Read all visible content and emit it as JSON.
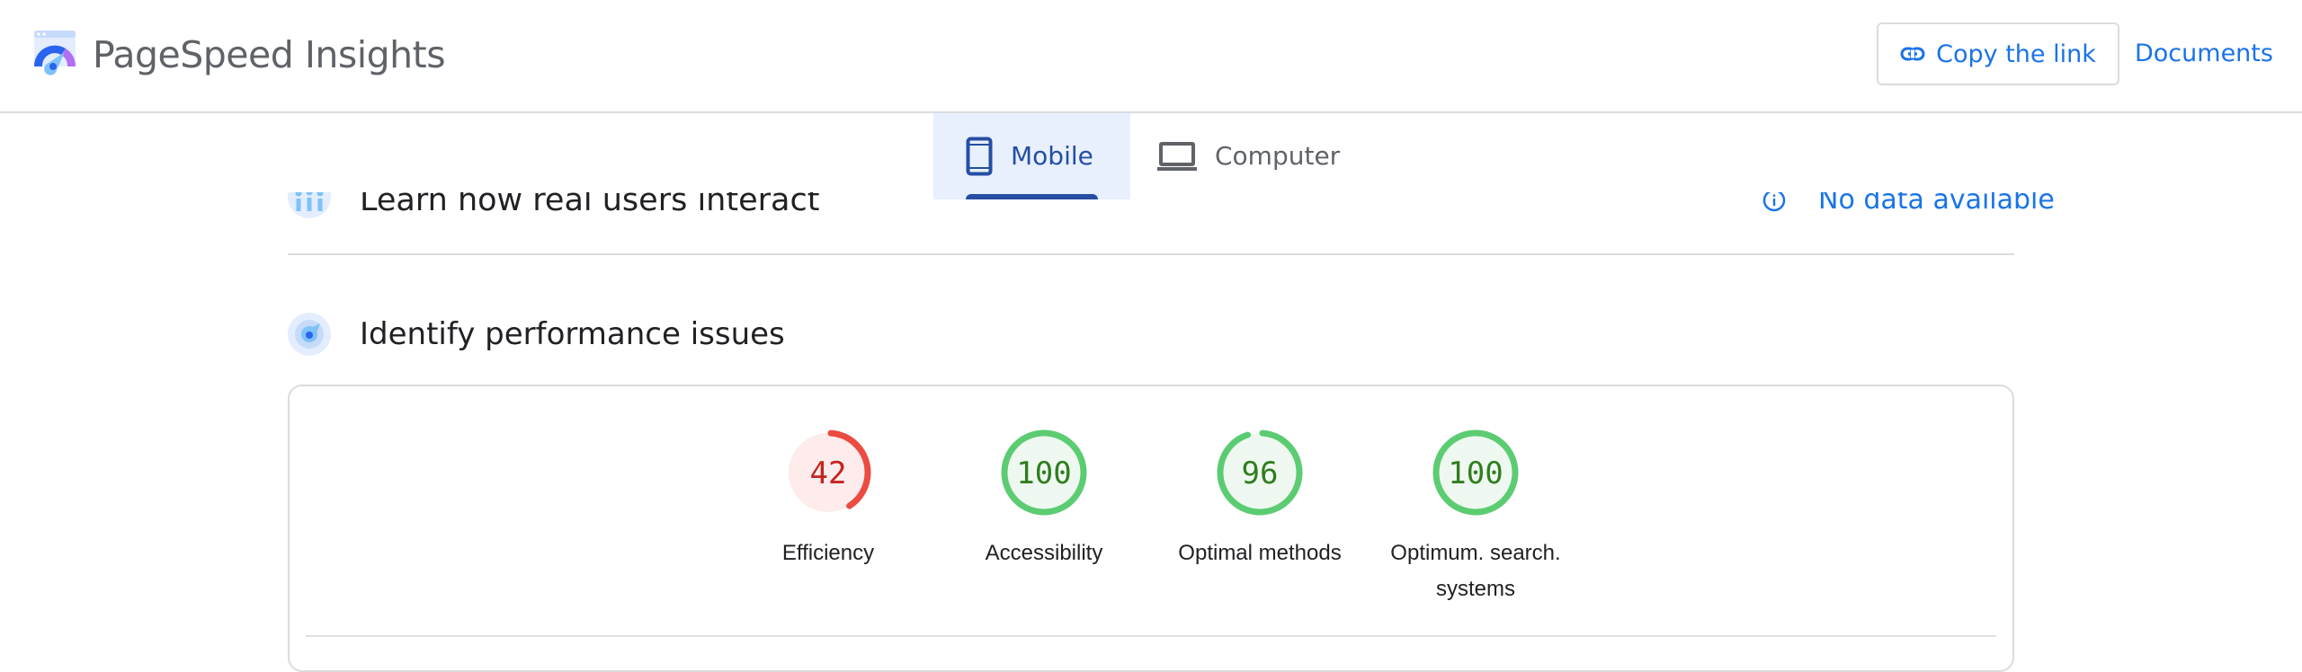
{
  "header": {
    "app_title": "PageSpeed Insights",
    "logo_icon": "pagespeed-logo-icon",
    "copy_link_label": "Copy the link",
    "copy_link_icon": "link-icon",
    "documents_label": "Documents"
  },
  "tabs": [
    {
      "label": "Mobile",
      "icon": "smartphone-icon",
      "active": true
    },
    {
      "label": "Computer",
      "icon": "laptop-icon",
      "active": false
    }
  ],
  "field_data_section": {
    "title": "Learn how real users interact",
    "icon": "users-chart-icon",
    "status_icon": "info-icon",
    "status_text": "No data available"
  },
  "lab_section": {
    "title": "Identify performance issues",
    "icon": "speed-gauge-icon",
    "scores": [
      {
        "label": "Efficiency",
        "value": 42,
        "status": "fail"
      },
      {
        "label": "Accessibility",
        "value": 100,
        "status": "pass"
      },
      {
        "label": "Optimal methods",
        "value": 96,
        "status": "pass"
      },
      {
        "label": "Optimum. search. systems",
        "value": 100,
        "status": "pass"
      }
    ]
  },
  "colors": {
    "accent": "#1a73e8",
    "tab_active": "#254ea3",
    "tab_active_bg": "#e8f0fe",
    "fail_stroke": "#eb4b40",
    "fail_fill": "#fdeceb",
    "fail_text": "#c5221f",
    "pass_stroke": "#5ccc72",
    "pass_fill": "#eef8f0",
    "pass_text": "#2f7d1f"
  }
}
